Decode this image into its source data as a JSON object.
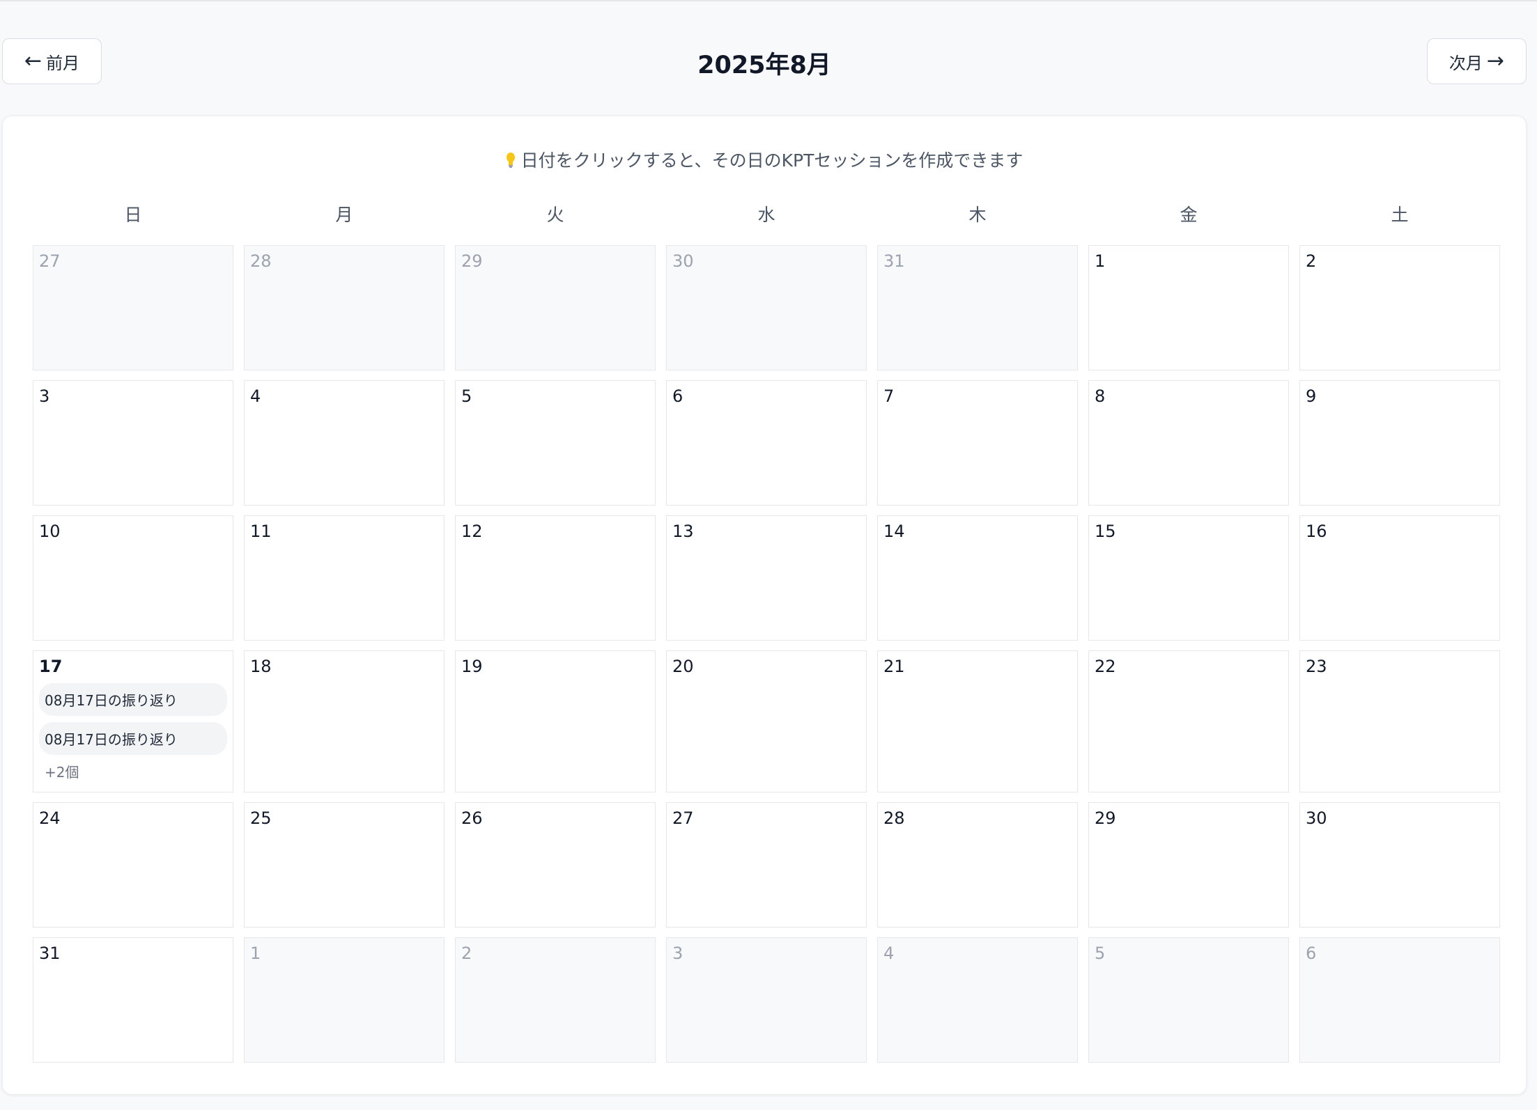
{
  "header": {
    "prev_arrow": "←",
    "prev_label": "前月",
    "title": "2025年8月",
    "next_label": "次月",
    "next_arrow": "→"
  },
  "hint": {
    "icon": "lightbulb-icon",
    "text": "日付をクリックすると、その日のKPTセッションを作成できます"
  },
  "weekdays": [
    "日",
    "月",
    "火",
    "水",
    "木",
    "金",
    "土"
  ],
  "days": [
    {
      "day": "27",
      "other": true
    },
    {
      "day": "28",
      "other": true
    },
    {
      "day": "29",
      "other": true
    },
    {
      "day": "30",
      "other": true
    },
    {
      "day": "31",
      "other": true
    },
    {
      "day": "1"
    },
    {
      "day": "2"
    },
    {
      "day": "3"
    },
    {
      "day": "4"
    },
    {
      "day": "5"
    },
    {
      "day": "6"
    },
    {
      "day": "7"
    },
    {
      "day": "8"
    },
    {
      "day": "9"
    },
    {
      "day": "10"
    },
    {
      "day": "11"
    },
    {
      "day": "12"
    },
    {
      "day": "13"
    },
    {
      "day": "14"
    },
    {
      "day": "15"
    },
    {
      "day": "16"
    },
    {
      "day": "17",
      "today": true,
      "sessions": [
        "08月17日の振り返り",
        "08月17日の振り返り"
      ],
      "more": "+2個"
    },
    {
      "day": "18"
    },
    {
      "day": "19"
    },
    {
      "day": "20"
    },
    {
      "day": "21"
    },
    {
      "day": "22"
    },
    {
      "day": "23"
    },
    {
      "day": "24"
    },
    {
      "day": "25"
    },
    {
      "day": "26"
    },
    {
      "day": "27"
    },
    {
      "day": "28"
    },
    {
      "day": "29"
    },
    {
      "day": "30"
    },
    {
      "day": "31"
    },
    {
      "day": "1",
      "other": true
    },
    {
      "day": "2",
      "other": true
    },
    {
      "day": "3",
      "other": true
    },
    {
      "day": "4",
      "other": true
    },
    {
      "day": "5",
      "other": true
    },
    {
      "day": "6",
      "other": true
    }
  ],
  "colors": {
    "page_bg": "#f8f9fb",
    "card_bg": "#ffffff",
    "cell_border": "#e5e7eb",
    "other_month_bg": "#f8f9fb",
    "other_month_text": "#9ca3af",
    "session_chip_bg": "#f3f4f6",
    "bulb": "#f5c518"
  }
}
